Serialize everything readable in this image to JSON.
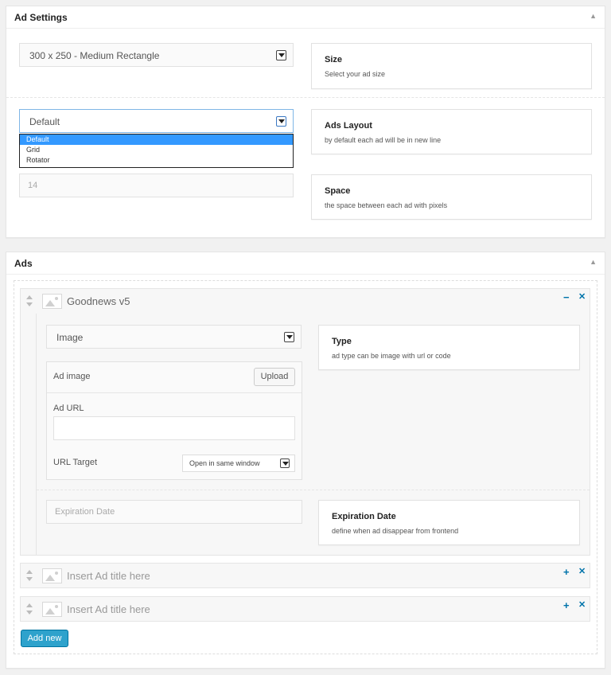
{
  "ad_settings": {
    "title": "Ad Settings",
    "size": {
      "value": "300 x 250 - Medium Rectangle",
      "label": "Size",
      "description": "Select your ad size"
    },
    "layout": {
      "value": "Default",
      "label": "Ads Layout",
      "description": "by default each ad will be in new line",
      "options": [
        "Default",
        "Grid",
        "Rotator"
      ],
      "selected_index": 0
    },
    "space": {
      "value": "14",
      "label": "Space",
      "description": "the space between each ad with pixels"
    }
  },
  "ads": {
    "title": "Ads",
    "expanded_item": {
      "title": "Goodnews v5",
      "type_value": "Image",
      "type_label": "Type",
      "type_description": "ad type can be image with url or code",
      "ad_image_label": "Ad image",
      "upload_label": "Upload",
      "ad_url_label": "Ad URL",
      "ad_url_value": "",
      "url_target_label": "URL Target",
      "url_target_value": "Open in same window",
      "expiration_placeholder": "Expiration Date",
      "expiration_label": "Expiration Date",
      "expiration_description": "define when ad disappear from frontend"
    },
    "collapsed_items": [
      {
        "title": "Insert Ad title here"
      },
      {
        "title": "Insert Ad title here"
      }
    ],
    "add_new_label": "Add new"
  },
  "icons": {
    "collapse": "▲",
    "minus": "−",
    "plus": "+",
    "remove": "✕"
  },
  "colors": {
    "accent": "#0073aa",
    "button": "#2ea2cc",
    "selected_option": "#3399ff"
  }
}
